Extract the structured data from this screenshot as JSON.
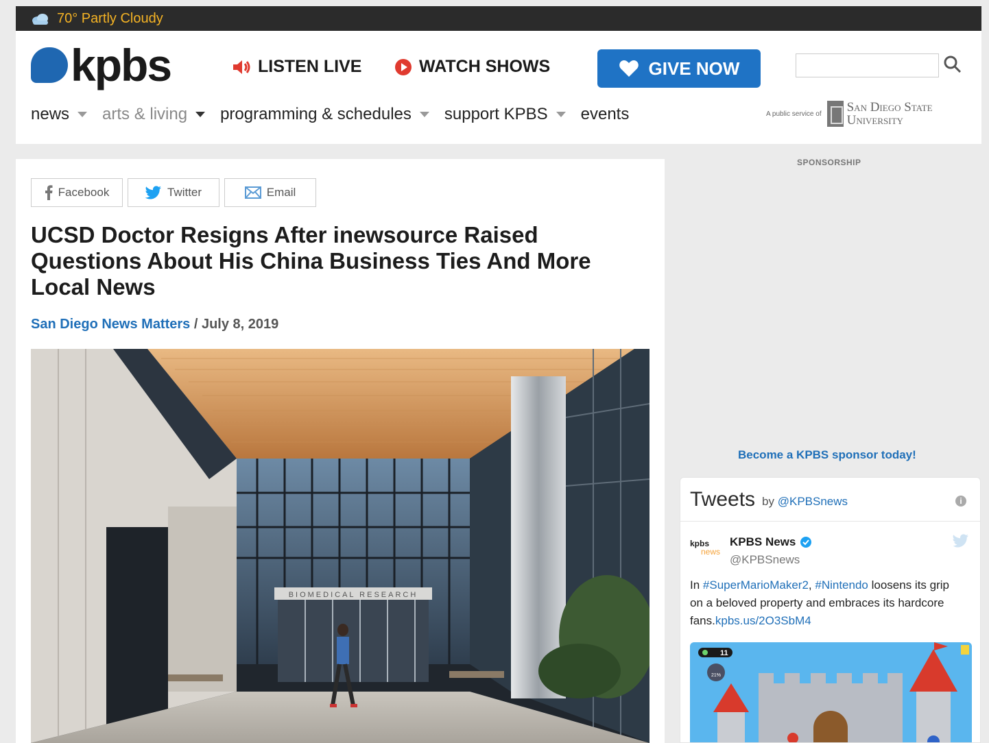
{
  "weather": {
    "text": "70° Partly Cloudy",
    "icon": "cloud-icon"
  },
  "brand": {
    "logo_text": "kpbs",
    "accent": "#1f67b1"
  },
  "header_links": {
    "listen": "LISTEN LIVE",
    "watch": "WATCH SHOWS",
    "give": "GIVE NOW"
  },
  "nav": {
    "items": [
      {
        "label": "news"
      },
      {
        "label": "arts & living"
      },
      {
        "label": "programming & schedules"
      },
      {
        "label": "support KPBS"
      },
      {
        "label": "events"
      }
    ]
  },
  "sdsu": {
    "prefix": "A public service of",
    "line1": "San Diego State",
    "line2": "University"
  },
  "share": {
    "facebook": "Facebook",
    "twitter": "Twitter",
    "email": "Email"
  },
  "article": {
    "headline": "UCSD Doctor Resigns After inewsource Raised Questions About His China Business Ties And More Local News",
    "source": "San Diego News Matters",
    "date": " / July 8, 2019",
    "image_sign": "BIOMEDICAL RESEARCH"
  },
  "sidebar": {
    "sponsorship_label": "SPONSORSHIP",
    "sponsor_link": "Become a KPBS sponsor today!"
  },
  "tweets": {
    "title": "Tweets",
    "by": "by ",
    "handle": "@KPBSnews",
    "info": "i",
    "tweet": {
      "avatar_top": "kpbs",
      "avatar_bottom": "news",
      "name": "KPBS News",
      "handle": "@KPBSnews",
      "text_1": "In ",
      "tag_1": "#SuperMarioMaker2",
      "text_2": ", ",
      "tag_2": "#Nintendo",
      "text_3": " loosens its grip on a beloved property and embraces its hardcore fans.",
      "link": "kpbs.us/2O3SbM4",
      "media_counter": "11",
      "media_percent": "21%"
    }
  }
}
